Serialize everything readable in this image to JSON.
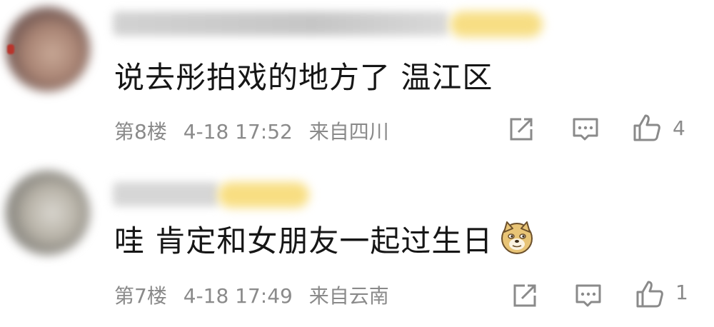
{
  "comments": [
    {
      "text": "说去彤拍戏的地方了 温江区",
      "floor": "第8楼",
      "date": "4-18 17:52",
      "location": "来自四川",
      "likes": "4",
      "icons": [
        "share-icon",
        "reply-icon",
        "like-icon"
      ]
    },
    {
      "text": "哇 肯定和女朋友一起过生日",
      "emoji": "doge-emoji",
      "floor": "第7楼",
      "date": "4-18 17:49",
      "location": "来自云南",
      "likes": "1",
      "icons": [
        "share-icon",
        "reply-icon",
        "like-icon"
      ]
    }
  ],
  "colors": {
    "text": "#161616",
    "meta": "#8a8a8a",
    "icon": "#8a8a8a",
    "badge": "#f7de84"
  }
}
